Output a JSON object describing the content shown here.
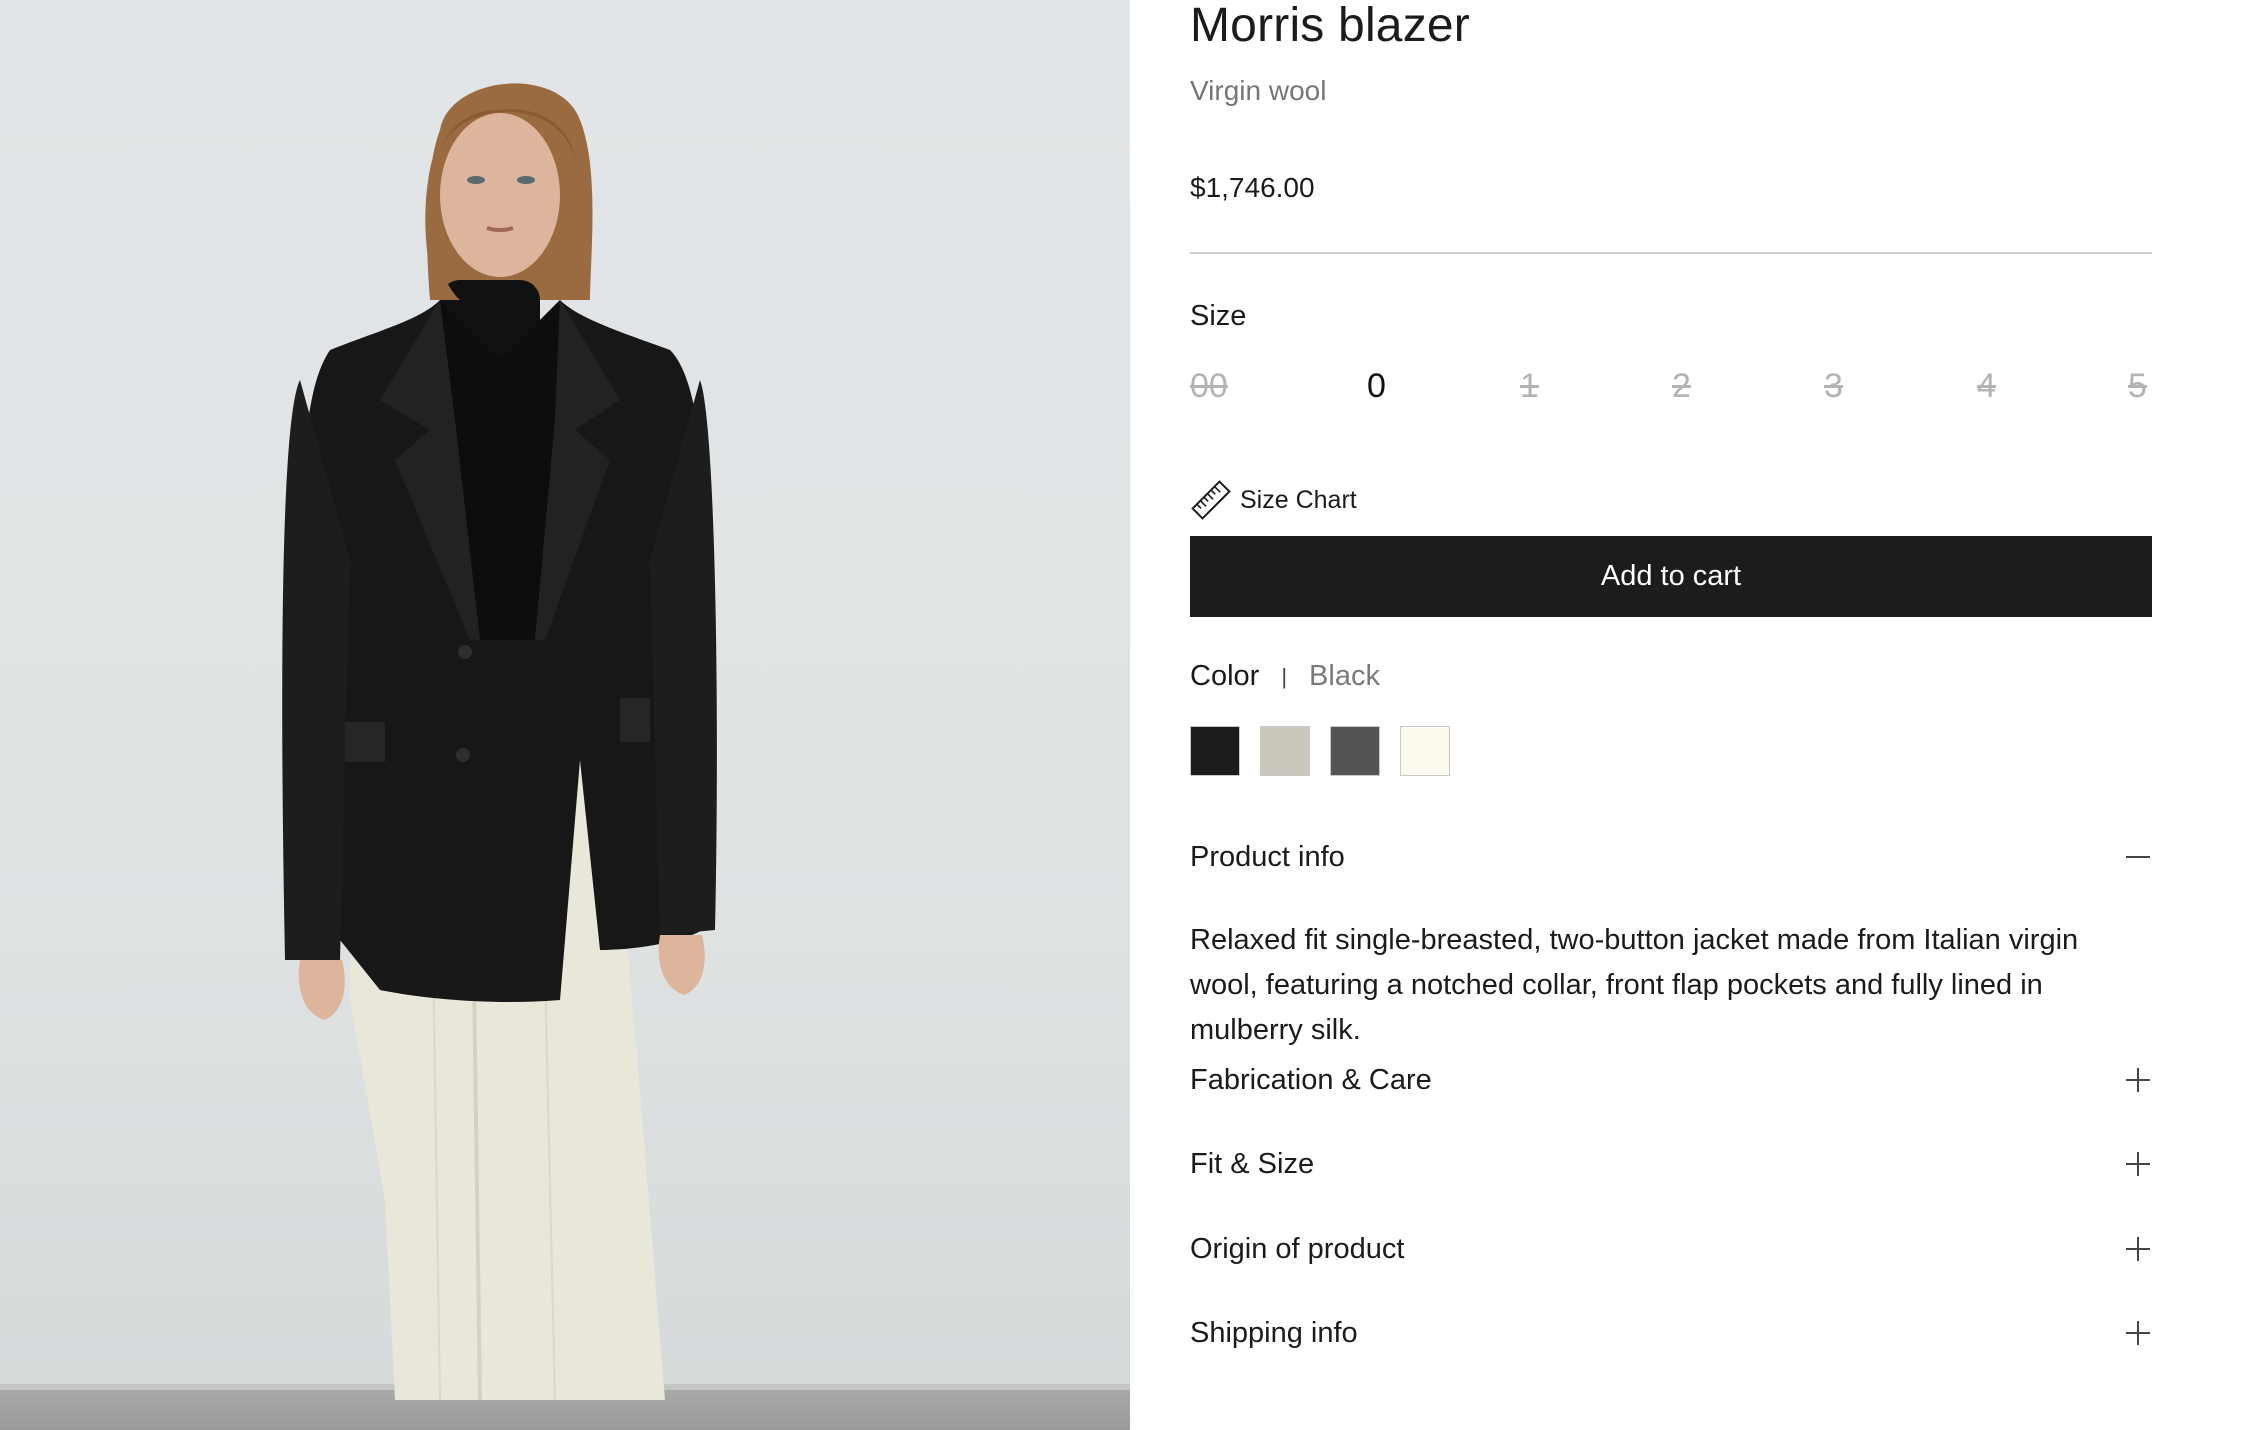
{
  "product": {
    "title": "Morris blazer",
    "subtitle": "Virgin wool",
    "price": "$1,746.00",
    "image_alt": "model wearing black blazer and cream trousers"
  },
  "size": {
    "label": "Size",
    "options": [
      {
        "label": "00",
        "available": false
      },
      {
        "label": "0",
        "available": true
      },
      {
        "label": "1",
        "available": false
      },
      {
        "label": "2",
        "available": false
      },
      {
        "label": "3",
        "available": false
      },
      {
        "label": "4",
        "available": false
      },
      {
        "label": "5",
        "available": false
      }
    ],
    "size_chart_label": "Size Chart"
  },
  "cart": {
    "add_label": "Add to cart"
  },
  "color": {
    "label": "Color",
    "separator": "|",
    "selected": "Black",
    "swatches": [
      {
        "name": "Black",
        "hex": "#1c1c1c"
      },
      {
        "name": "Stone",
        "hex": "#c9c6bb"
      },
      {
        "name": "Charcoal",
        "hex": "#525456"
      },
      {
        "name": "Ivory",
        "hex": "#fcf9ee"
      }
    ]
  },
  "accordion": {
    "product_info": {
      "title": "Product info",
      "expanded": true,
      "body": "Relaxed fit single-breasted, two-button jacket made from Italian virgin wool, featuring a notched collar, front flap pockets and fully lined in mulberry silk."
    },
    "fabrication": {
      "title": "Fabrication & Care",
      "expanded": false
    },
    "fit": {
      "title": "Fit & Size",
      "expanded": false
    },
    "origin": {
      "title": "Origin of product",
      "expanded": false
    },
    "shipping": {
      "title": "Shipping info",
      "expanded": false
    }
  },
  "colors": {
    "accent": "#1c1c1c",
    "muted_text": "#767676",
    "unavailable": "#b3b3b3",
    "divider": "#cfcfcf"
  }
}
